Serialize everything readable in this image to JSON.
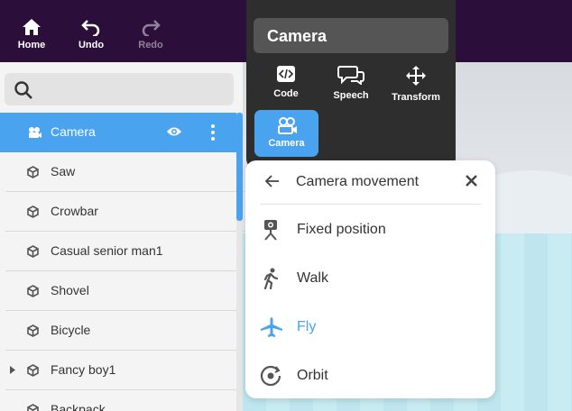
{
  "toolbar": {
    "home_label": "Home",
    "undo_label": "Undo",
    "redo_label": "Redo"
  },
  "search": {
    "placeholder": ""
  },
  "scene_items": [
    {
      "label": "Camera",
      "icon": "camera-icon",
      "selected": true
    },
    {
      "label": "Saw",
      "icon": "cube-icon"
    },
    {
      "label": "Crowbar",
      "icon": "cube-icon"
    },
    {
      "label": "Casual senior man1",
      "icon": "cube-icon"
    },
    {
      "label": "Shovel",
      "icon": "cube-icon"
    },
    {
      "label": "Bicycle",
      "icon": "cube-icon"
    },
    {
      "label": "Fancy boy1",
      "icon": "cube-icon",
      "expandable": true
    },
    {
      "label": "Backpack",
      "icon": "cube-icon"
    }
  ],
  "properties": {
    "title": "Camera",
    "buttons": [
      {
        "label": "Code",
        "icon": "code-icon"
      },
      {
        "label": "Speech",
        "icon": "speech-icon"
      },
      {
        "label": "Transform",
        "icon": "move-icon"
      },
      {
        "label": "Camera",
        "icon": "camera-icon",
        "active": true
      }
    ]
  },
  "camera_menu": {
    "title": "Camera movement",
    "options": [
      {
        "label": "Fixed position",
        "icon": "tripod-camera-icon"
      },
      {
        "label": "Walk",
        "icon": "walk-icon"
      },
      {
        "label": "Fly",
        "icon": "airplane-icon",
        "active": true
      },
      {
        "label": "Orbit",
        "icon": "orbit-icon"
      }
    ]
  },
  "colors": {
    "topbar": "#2b0f3a",
    "accent": "#4aa3ef",
    "panel_dark": "#2e2e2e",
    "panel_light": "#f4f4f4"
  }
}
